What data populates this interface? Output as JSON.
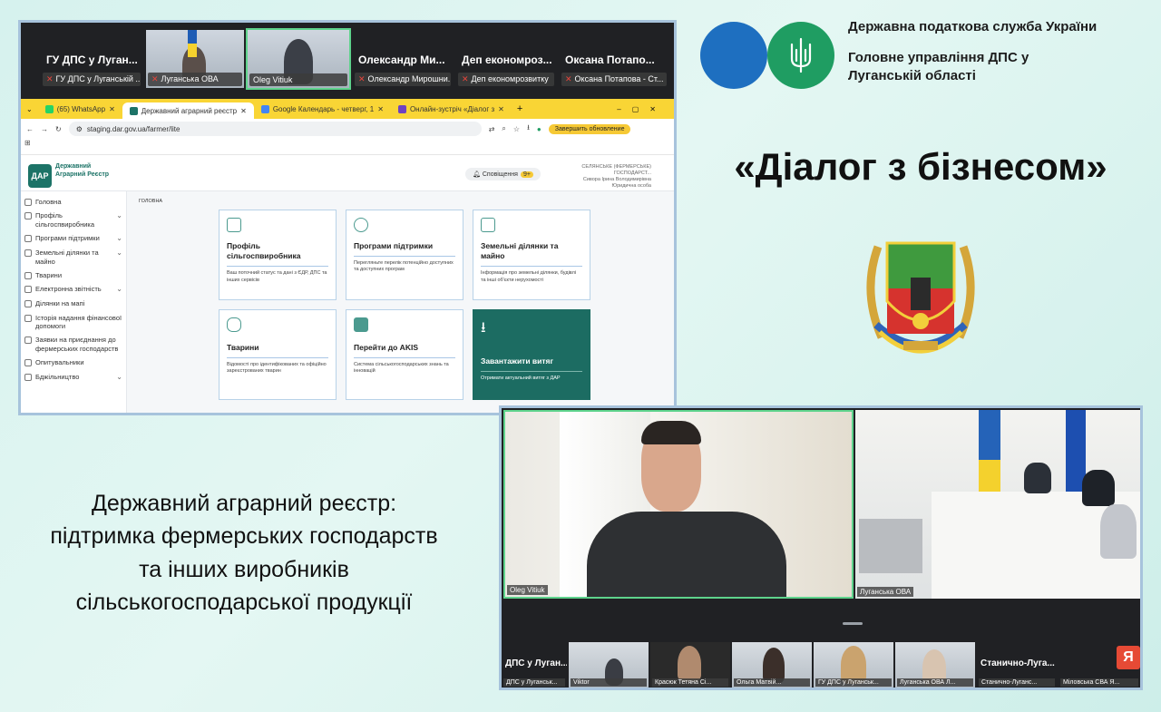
{
  "meeting_top": {
    "tiles": [
      {
        "name": "ГУ ДПС у Луган...",
        "sub": "ГУ ДПС у Луганській ..."
      },
      {
        "name": "",
        "sub": "Луганська ОВА"
      },
      {
        "name": "",
        "sub": "Oleg Vitiuk"
      },
      {
        "name": "Олександр Ми...",
        "sub": "Олександр Мирошни..."
      },
      {
        "name": "Деп економроз...",
        "sub": "Деп економрозвитку"
      },
      {
        "name": "Оксана Потапо...",
        "sub": "Оксана Потапова - Ст..."
      }
    ]
  },
  "browser": {
    "tabs": [
      {
        "label": "(65) WhatsApp",
        "color": "#25d366"
      },
      {
        "label": "Державний аграрний реєстр",
        "color": "#1c7367"
      },
      {
        "label": "Google Календарь - четверг, 1",
        "color": "#4285f4"
      },
      {
        "label": "Онлайн-зустріч «Діалог з",
        "color": "#6f42c1"
      }
    ],
    "url": "staging.dar.gov.ua/farmer/lite",
    "update_button": "Завершить обновление"
  },
  "site": {
    "logo_short": "ДАР",
    "logo_text": "Державний Аграрний Реєстр",
    "notifications_label": "Сповіщення",
    "notifications_count": "9+",
    "user_lines": [
      "СЕЛЯНСЬКЕ (ФЕРМЕРСЬКЕ) ГОСПОДАРСТ...",
      "Сивора Ірина Володимирівна",
      "Юридична особа"
    ],
    "breadcrumb": "ГОЛОВНА",
    "sidebar": [
      {
        "label": "Головна",
        "chevron": false
      },
      {
        "label": "Профіль сільгоспвиробника",
        "chevron": true
      },
      {
        "label": "Програми підтримки",
        "chevron": true
      },
      {
        "label": "Земельні ділянки та майно",
        "chevron": true
      },
      {
        "label": "Тварини",
        "chevron": false
      },
      {
        "label": "Електронна звітність",
        "chevron": true
      },
      {
        "label": "Ділянки на мапі",
        "chevron": false
      },
      {
        "label": "Історія надання фінансової допомоги",
        "chevron": false
      },
      {
        "label": "Заявки на приєднання до фермерських господарств",
        "chevron": false
      },
      {
        "label": "Опитувальники",
        "chevron": false
      },
      {
        "label": "Бджільництво",
        "chevron": true
      }
    ],
    "cards": [
      {
        "title": "Профіль сільгоспвиробника",
        "desc": "Ваш поточний статус та дані з ЄДР, ДПС та інших сервісів",
        "icon": "profile-icon"
      },
      {
        "title": "Програми підтримки",
        "desc": "Перегляньте перелік потенційно доступних та доступних програм",
        "icon": "handshake-icon"
      },
      {
        "title": "Земельні ділянки та майно",
        "desc": "Інформація про земельні ділянки, будівлі та інші об'єкти нерухомості",
        "icon": "land-icon"
      },
      {
        "title": "Тварини",
        "desc": "Відомості про ідентифікованих та офіційно зареєстрованих тварин",
        "icon": "cow-icon"
      },
      {
        "title": "Перейти до AKIS",
        "desc": "Система сільськогосподарських знань та інновацій",
        "icon": "akis-icon"
      },
      {
        "title": "Завантажити витяг",
        "desc": "Отримати актуальний витяг з ДАР",
        "icon": "download-icon"
      }
    ]
  },
  "header": {
    "org_line1": "Державна податкова служба України",
    "org_line2": "Головне управління ДПС у Луганській області",
    "headline": "«Діалог з бізнесом»"
  },
  "caption": {
    "lines": [
      "Державний аграрний реєстр:",
      "підтримка фермерських господарств",
      "та інших виробників",
      "сільськогосподарської продукції"
    ]
  },
  "meeting_bottom": {
    "main_label": "Oleg Vitiuk",
    "room_label": "Луганська ОВА",
    "thumbs": [
      {
        "name": "ДПС у Луган...",
        "sub": "ДПС у Луганськ..."
      },
      {
        "name": "",
        "sub": "Viktor"
      },
      {
        "name": "",
        "sub": "Красюк Тетяна Сі..."
      },
      {
        "name": "",
        "sub": "Ольга Матвій..."
      },
      {
        "name": "",
        "sub": "ГУ ДПС у Луганськ..."
      },
      {
        "name": "",
        "sub": "Луганська ОВА Л..."
      },
      {
        "name": "Станично-Луга...",
        "sub": "Станично-Луганс..."
      },
      {
        "name": "",
        "sub": "Міловська СВА Я..."
      }
    ],
    "avatar_letter": "Я"
  },
  "colors": {
    "accent_green": "#1c6c62",
    "chrome_yellow": "#f9d535",
    "blue": "#1e6fc0",
    "green": "#1f9d62"
  }
}
